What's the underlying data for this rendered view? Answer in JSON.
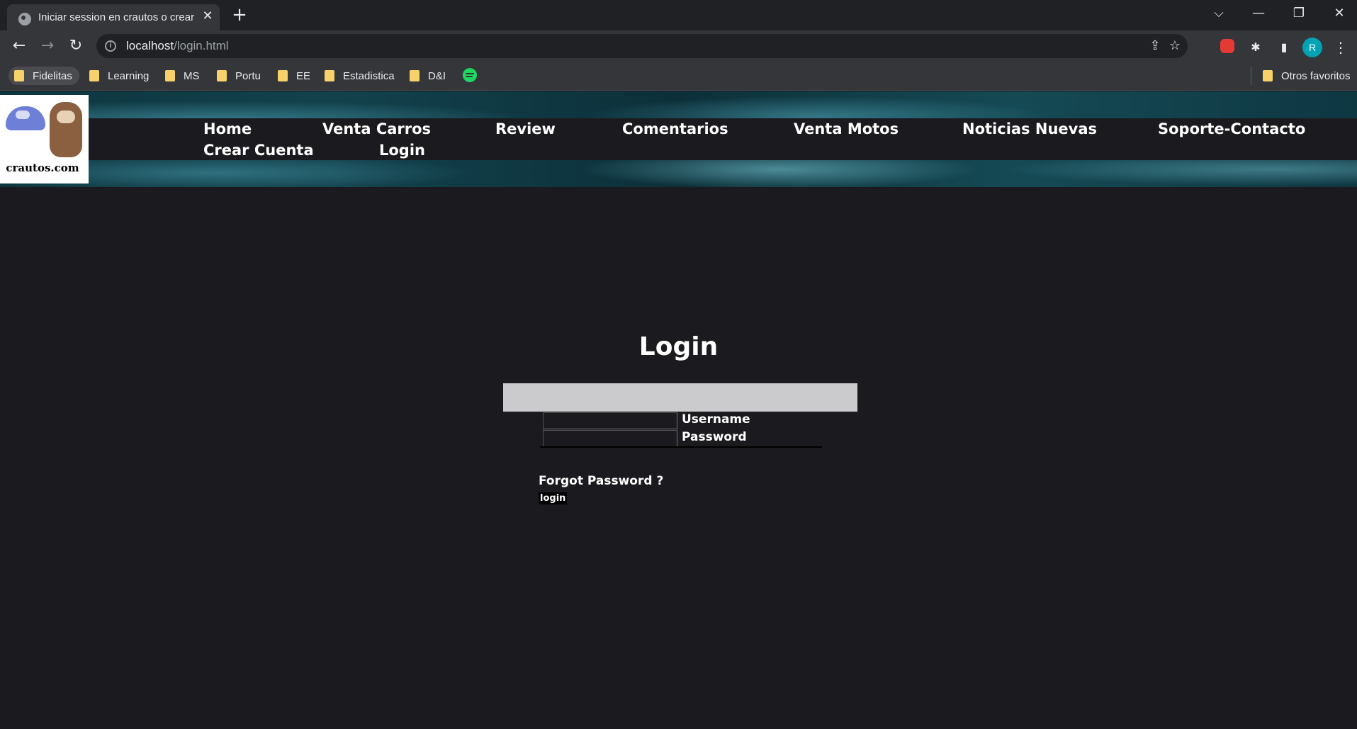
{
  "browser": {
    "tab_title": "Iniciar session en crautos o crear",
    "tab_close": "✕",
    "new_tab": "+",
    "window_controls": {
      "menu": "⌵",
      "minimize": "—",
      "restore": "❐",
      "close": "✕"
    },
    "url_host": "localhost",
    "url_path": "/login.html",
    "nav": {
      "back": "←",
      "forward": "→",
      "reload": "↻"
    },
    "icons": {
      "share": "⇪",
      "star": "☆",
      "puzzle": "✱",
      "sidepanel": "▮",
      "menu": "⋮",
      "info": "i"
    },
    "profile_initial": "R",
    "bookmarks": [
      {
        "label": "Fidelitas"
      },
      {
        "label": "Learning"
      },
      {
        "label": "MS"
      },
      {
        "label": "Portu"
      },
      {
        "label": "EE"
      },
      {
        "label": "Estadistica"
      },
      {
        "label": "D&I"
      }
    ],
    "other_bookmarks": "Otros favoritos"
  },
  "site": {
    "logo_text": "crautos.com",
    "nav": {
      "home": "Home",
      "venta_carros": "Venta Carros",
      "review": "Review",
      "comentarios": "Comentarios",
      "venta_motos": "Venta Motos",
      "noticias": "Noticias Nuevas",
      "soporte": "Soporte-Contacto",
      "crear_cuenta": "Crear Cuenta",
      "login": "Login"
    }
  },
  "login": {
    "title": "Login",
    "username_label": "Username",
    "password_label": "Password",
    "forgot": "Forgot Password ?",
    "button": "login"
  }
}
